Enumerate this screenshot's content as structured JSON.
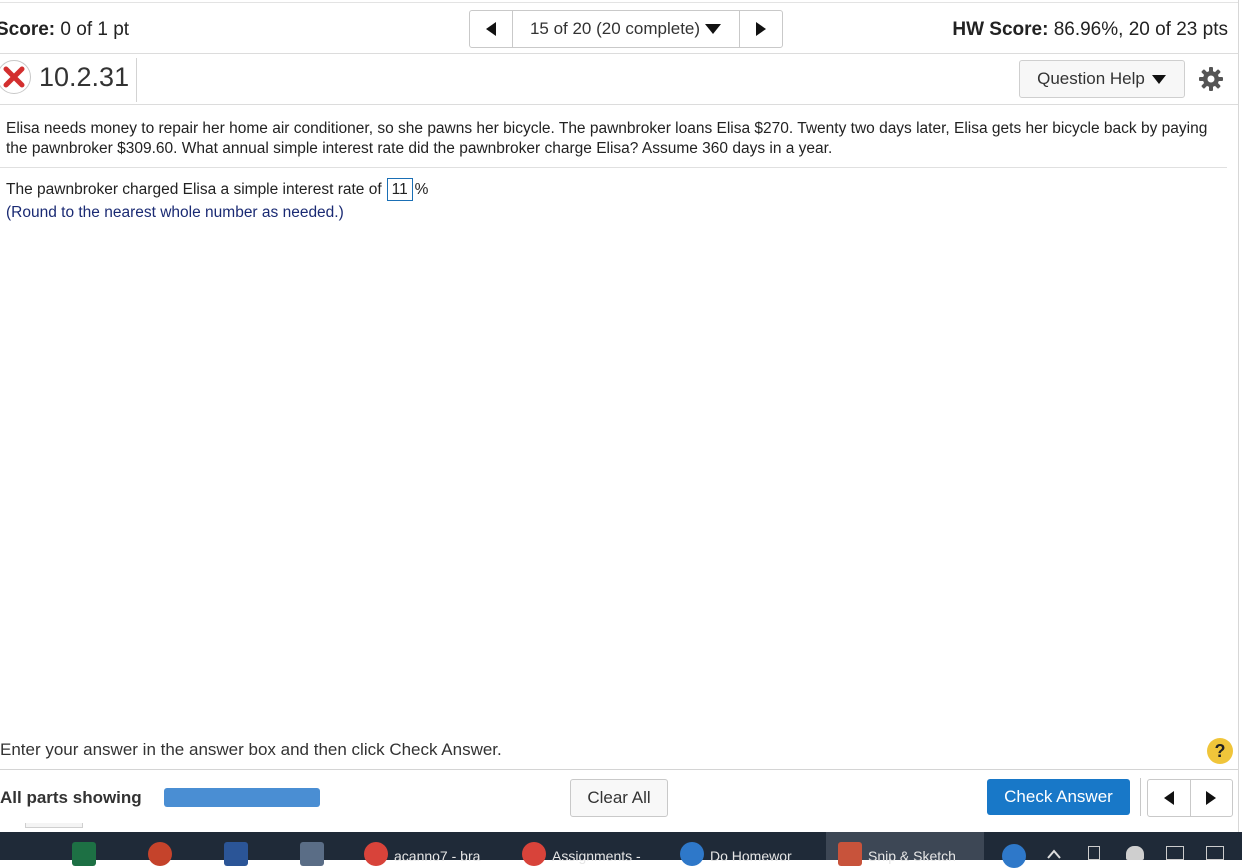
{
  "topbar": {
    "score_label": "Score:",
    "score_value": "0 of 1 pt",
    "nav_position": "15 of 20 (20 complete)",
    "hw_label": "HW Score:",
    "hw_value": "86.96%, 20 of 23 pts"
  },
  "question": {
    "number": "10.2.31",
    "status": "incorrect",
    "help_label": "Question Help",
    "text": "Elisa needs money to repair her home air conditioner, so she pawns her bicycle. The pawnbroker loans Elisa $270. Twenty two days later, Elisa gets her bicycle back by paying the pawnbroker $309.60. What annual simple interest rate did the pawnbroker charge Elisa? Assume 360 days in a year.",
    "answer_prefix": "The pawnbroker charged Elisa a simple interest rate of",
    "answer_value": "11",
    "answer_suffix": "%",
    "hint": "(Round to the nearest whole number as needed.)"
  },
  "footer": {
    "instruction": "Enter your answer in the answer box and then click Check Answer.",
    "help_symbol": "?",
    "all_parts_label": "All parts showing",
    "progress": 1.0,
    "clear_label": "Clear All",
    "check_label": "Check Answer"
  },
  "taskbar": {
    "items": [
      {
        "icon": "excel-icon",
        "label": "",
        "color": "#1d7044"
      },
      {
        "icon": "powerpoint-icon",
        "label": "",
        "color": "#c5432b"
      },
      {
        "icon": "word-icon",
        "label": "",
        "color": "#2b5597"
      },
      {
        "icon": "calculator-icon",
        "label": "",
        "color": "#5a6d86"
      },
      {
        "icon": "chrome-icon",
        "label": "acanno7 - bra",
        "color": "#d8433a"
      },
      {
        "icon": "chrome-icon",
        "label": "Assignments -",
        "color": "#d8433a"
      },
      {
        "icon": "pearson-icon",
        "label": "Do Homewor",
        "color": "#2e78c9"
      },
      {
        "icon": "snip-sketch-icon",
        "label": "Snip & Sketch",
        "color": "#c8533b"
      }
    ]
  },
  "colors": {
    "accent": "#1878c8",
    "progress": "#4a8ed3",
    "incorrect": "#d32f2f",
    "hint": "#1a2a73",
    "help_badge": "#f0c53a"
  }
}
